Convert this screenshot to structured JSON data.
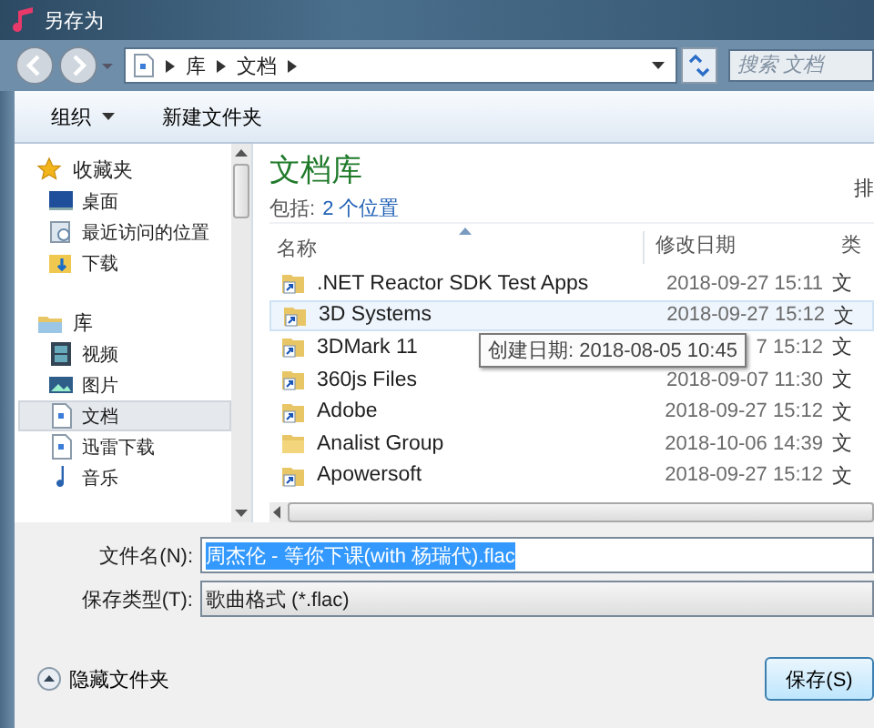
{
  "window": {
    "title": "另存为"
  },
  "navigation": {
    "breadcrumbs": [
      "库",
      "文档"
    ],
    "search": {
      "placeholder": "搜索 文档"
    }
  },
  "toolbar": [
    {
      "label": "组织",
      "dropdown": true
    },
    {
      "label": "新建文件夹",
      "dropdown": false
    }
  ],
  "sidebar": {
    "groups": [
      {
        "label": "收藏夹",
        "kind": "favorites",
        "items": [
          {
            "label": "桌面",
            "kind": "desktop",
            "selected": false
          },
          {
            "label": "最近访问的位置",
            "kind": "recent",
            "selected": false
          },
          {
            "label": "下载",
            "kind": "download",
            "selected": false
          }
        ]
      },
      {
        "label": "库",
        "kind": "library",
        "items": [
          {
            "label": "视频",
            "kind": "video",
            "selected": false
          },
          {
            "label": "图片",
            "kind": "picture",
            "selected": false
          },
          {
            "label": "文档",
            "kind": "document",
            "selected": true
          },
          {
            "label": "迅雷下载",
            "kind": "document",
            "selected": false
          },
          {
            "label": "音乐",
            "kind": "music",
            "selected": false
          }
        ]
      }
    ]
  },
  "content": {
    "title": "文档库",
    "includes_label": "包括:",
    "includes_link": "2 个位置",
    "arrange_label": "排",
    "columns": [
      "名称",
      "修改日期",
      "类"
    ],
    "rows": [
      {
        "name": ".NET Reactor SDK Test Apps",
        "date": "2018-09-27 15:11",
        "type": "文",
        "kind": "shortcut",
        "selected": false
      },
      {
        "name": "3D Systems",
        "date": "2018-09-27 15:12",
        "type": "文",
        "kind": "shortcut",
        "selected": true
      },
      {
        "name": "3DMark 11",
        "date": "7 15:12",
        "type": "文",
        "kind": "shortcut",
        "selected": false,
        "tooltip": "创建日期: 2018-08-05 10:45"
      },
      {
        "name": "360js Files",
        "date": "2018-09-07 11:30",
        "type": "文",
        "kind": "shortcut",
        "selected": false
      },
      {
        "name": "Adobe",
        "date": "2018-09-27 15:12",
        "type": "文",
        "kind": "shortcut",
        "selected": false
      },
      {
        "name": "Analist Group",
        "date": "2018-10-06 14:39",
        "type": "文",
        "kind": "folder",
        "selected": false
      },
      {
        "name": "Apowersoft",
        "date": "2018-09-27 15:12",
        "type": "文",
        "kind": "shortcut",
        "selected": false
      }
    ]
  },
  "save_panel": {
    "filename": {
      "label": "文件名(N):",
      "value": "周杰伦 - 等你下课(with 杨瑞代).flac",
      "selected": true
    },
    "filetype": {
      "label": "保存类型(T):",
      "value": "歌曲格式 (*.flac)"
    },
    "hide_folders": "隐藏文件夹",
    "save_button": "保存(S)"
  }
}
